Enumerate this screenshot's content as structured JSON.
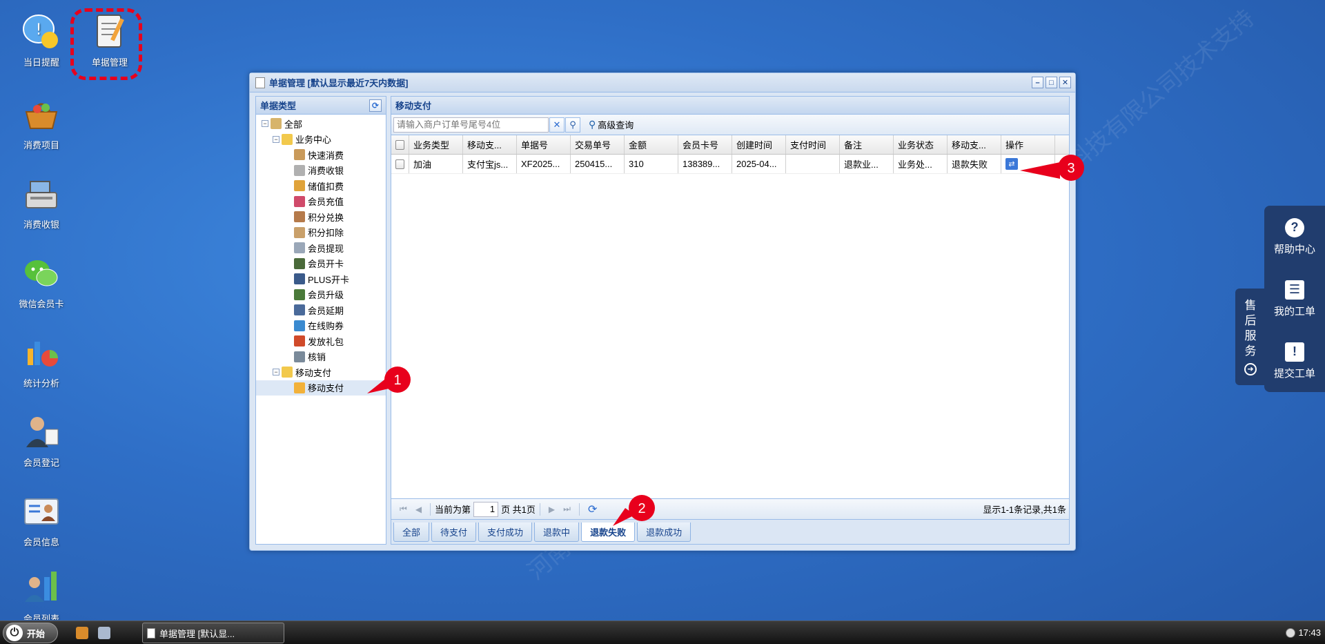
{
  "desktop_icons": [
    {
      "label": "当日提醒",
      "icon": "reminder-icon"
    },
    {
      "label": "单据管理",
      "icon": "notebook-icon"
    },
    {
      "label": "消费项目",
      "icon": "basket-icon"
    },
    {
      "label": "消费收银",
      "icon": "cash-register-icon"
    },
    {
      "label": "微信会员卡",
      "icon": "wechat-icon"
    },
    {
      "label": "统计分析",
      "icon": "chart-icon"
    },
    {
      "label": "会员登记",
      "icon": "member-register-icon"
    },
    {
      "label": "会员信息",
      "icon": "member-info-icon"
    },
    {
      "label": "会员列表",
      "icon": "member-list-icon"
    }
  ],
  "window": {
    "title": "单据管理 [默认显示最近7天内数据]",
    "controls": [
      "–",
      "□",
      "✕"
    ]
  },
  "left_panel": {
    "title": "单据类型",
    "tree": [
      {
        "label": "全部",
        "level": 0,
        "toggle": "−"
      },
      {
        "label": "业务中心",
        "level": 1,
        "toggle": "−"
      },
      {
        "label": "快速消费",
        "level": 2
      },
      {
        "label": "消费收银",
        "level": 2
      },
      {
        "label": "储值扣费",
        "level": 2
      },
      {
        "label": "会员充值",
        "level": 2
      },
      {
        "label": "积分兑换",
        "level": 2
      },
      {
        "label": "积分扣除",
        "level": 2
      },
      {
        "label": "会员提现",
        "level": 2
      },
      {
        "label": "会员开卡",
        "level": 2
      },
      {
        "label": "PLUS开卡",
        "level": 2
      },
      {
        "label": "会员升级",
        "level": 2
      },
      {
        "label": "会员延期",
        "level": 2
      },
      {
        "label": "在线购券",
        "level": 2
      },
      {
        "label": "发放礼包",
        "level": 2
      },
      {
        "label": "核销",
        "level": 2
      },
      {
        "label": "移动支付",
        "level": 1,
        "toggle": "−"
      },
      {
        "label": "移动支付",
        "level": 2,
        "selected": true
      }
    ]
  },
  "right_panel": {
    "title": "移动支付",
    "search_placeholder": "请输入商户订单号尾号4位",
    "advanced_search": "高级查询",
    "columns": [
      "业务类型",
      "移动支...",
      "单据号",
      "交易单号",
      "金额",
      "会员卡号",
      "创建时间",
      "支付时间",
      "备注",
      "业务状态",
      "移动支...",
      "操作"
    ],
    "rows": [
      [
        "加油",
        "支付宝js...",
        "XF2025...",
        "250415...",
        "310",
        "138389...",
        "2025-04...",
        "",
        "退款业...",
        "业务处...",
        "退款失败",
        ""
      ]
    ],
    "pager": {
      "prefix": "当前为第",
      "page": "1",
      "suffix": "页 共1页",
      "display": "显示1-1条记录,共1条"
    },
    "tabs": [
      "全部",
      "待支付",
      "支付成功",
      "退款中",
      "退款失败",
      "退款成功"
    ],
    "active_tab": "退款失败"
  },
  "markers": [
    "1",
    "2",
    "3"
  ],
  "side_panel": {
    "items": [
      "帮助中心",
      "我的工单",
      "提交工单"
    ],
    "after_sale": [
      "售",
      "后",
      "服",
      "务"
    ]
  },
  "taskbar": {
    "start": "开始",
    "task": "单据管理 [默认显...",
    "time": "17:43"
  },
  "watermark": "河南钱客多网络科技有限公司技术支持",
  "colors": {
    "accent": "#15428b",
    "marker": "#e8001c",
    "desktop": "#2f6fc7"
  }
}
